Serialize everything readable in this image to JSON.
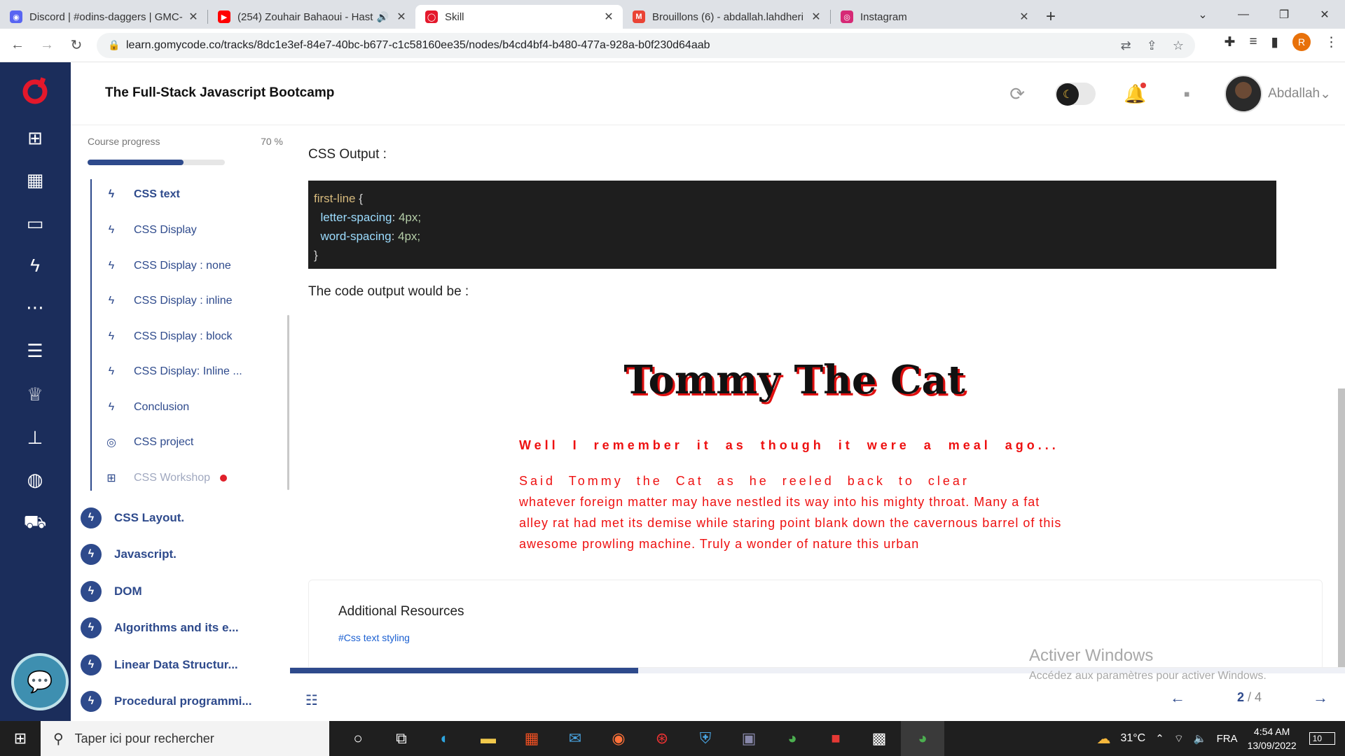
{
  "browser": {
    "tabs": [
      {
        "title": "Discord | #odins-daggers | GMC-",
        "icon": "discord-icon",
        "color": "#5865f2"
      },
      {
        "title": "(254) Zouhair Bahaoui - Hast",
        "icon": "youtube-icon",
        "color": "#ff0000"
      },
      {
        "title": "Skill",
        "icon": "gomycode-icon",
        "color": "#e4182b"
      },
      {
        "title": "Brouillons (6) - abdallah.lahdheri",
        "icon": "gmail-icon",
        "color": "#ea4335"
      },
      {
        "title": "Instagram",
        "icon": "instagram-icon",
        "color": "#d62976"
      }
    ],
    "url": "learn.gomycode.co/tracks/8dc1e3ef-84e7-40bc-b677-c1c58160ee35/nodes/b4cd4bf4-b480-477a-928a-b0f230d64aab",
    "profile_initial": "R"
  },
  "app": {
    "title": "The Full-Stack Javascript Bootcamp",
    "username": "Abdallah",
    "accent": "#2e4a8c"
  },
  "sidebar": {
    "progress_label": "Course progress",
    "progress_text": "70 %",
    "progress_value": 0.7,
    "sub_items": [
      {
        "label": "CSS text",
        "active": true
      },
      {
        "label": "CSS Display"
      },
      {
        "label": "CSS Display : none"
      },
      {
        "label": "CSS Display : inline"
      },
      {
        "label": "CSS Display : block"
      },
      {
        "label": "CSS Display: Inline ..."
      },
      {
        "label": "Conclusion"
      },
      {
        "label": "CSS project"
      },
      {
        "label": "CSS Workshop"
      }
    ],
    "chapters": [
      "CSS Layout.",
      "Javascript.",
      "DOM",
      "Algorithms and its e...",
      "Linear Data Structur...",
      "Procedural programmi..."
    ]
  },
  "content": {
    "css_output_label": "CSS Output :",
    "code": {
      "selector": "first-line",
      "open": " {",
      "prop1": "letter-spacing",
      "val1": "4px;",
      "prop2": "word-spacing",
      "val2": "4px;",
      "close": "}"
    },
    "code_output_label": "The code output would be :",
    "demo_title": "Tommy The Cat",
    "demo_subtitle": "Well I remember it as though it were a meal ago...",
    "demo_first_line": "Said Tommy the Cat as he reeled back to clear",
    "demo_rest": "whatever foreign matter may have nestled its way into his mighty throat. Many a fat alley rat had met its demise while staring point blank down the cavernous barrel of this awesome prowling machine. Truly a wonder of nature this urban",
    "resources_title": "Additional Resources",
    "resources_link": "#Css text styling"
  },
  "pager": {
    "current": "2",
    "total": "/ 4",
    "progress_value": 0.33
  },
  "watermark": {
    "line1": "Activer Windows",
    "line2": "Accédez aux paramètres pour activer Windows."
  },
  "taskbar": {
    "search_placeholder": "Taper ici pour rechercher",
    "temperature": "31°C",
    "language": "FRA",
    "time": "4:54 AM",
    "date": "13/09/2022",
    "notifications": "10"
  }
}
